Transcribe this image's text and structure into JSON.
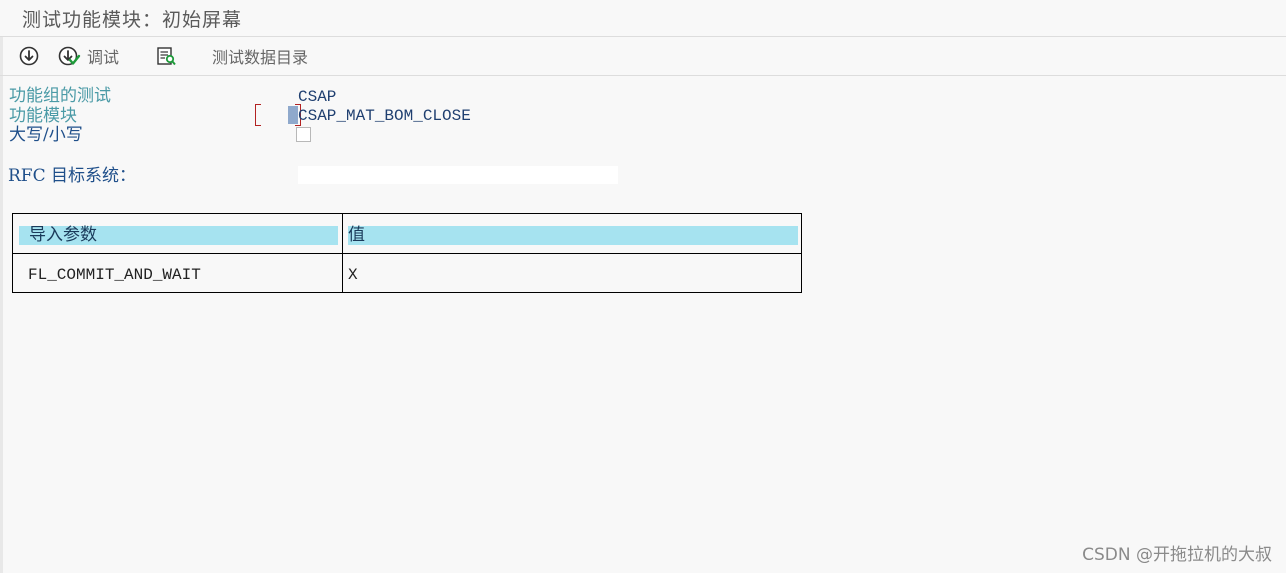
{
  "window": {
    "title": "测试功能模块：初始屏幕"
  },
  "toolbar": {
    "execute_icon": "execute-icon",
    "debug_label": "调试",
    "debug_icon": "execute-debug-icon",
    "datadir_icon": "data-directory-icon",
    "test_data_dir_label": "测试数据目录"
  },
  "form": {
    "function_group_label": "功能组的测试",
    "function_group_value": "CSAP",
    "function_module_label": "功能模块",
    "function_module_value": "CSAP_MAT_BOM_CLOSE",
    "case_label": "大写/小写",
    "case_checked": false,
    "rfc_label": "RFC 目标系统：",
    "rfc_value": ""
  },
  "import_table": {
    "columns": [
      "导入参数",
      "值"
    ],
    "rows": [
      {
        "param": "FL_COMMIT_AND_WAIT",
        "value": "X"
      }
    ]
  },
  "watermark": "CSDN @开拖拉机的大叔",
  "colors": {
    "header_bg": "#a6e3f0",
    "label_teal": "#4a9aa6",
    "label_blue": "#1f4f8a",
    "required_bracket": "#b22222"
  }
}
